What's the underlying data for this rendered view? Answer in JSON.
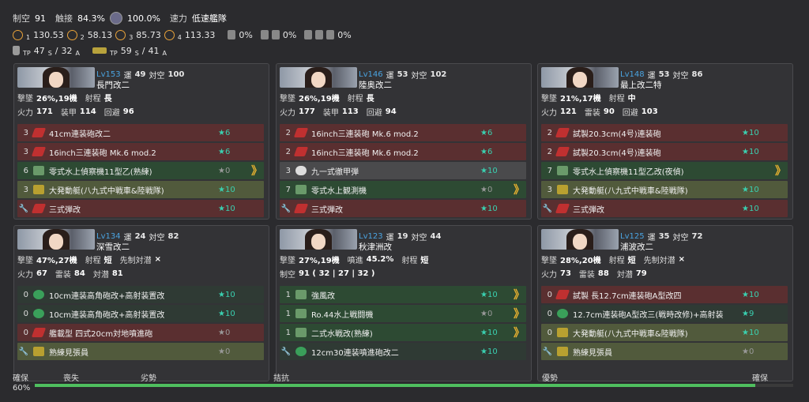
{
  "summary": {
    "air_label": "制空",
    "air_value": "91",
    "contact_label": "触接",
    "contact_value": "84.3%",
    "select_value": "100.0%",
    "speed_label": "速力",
    "speed_value": "低速艦隊",
    "los": [
      "130.53",
      "58.13",
      "85.73",
      "113.33"
    ],
    "los_subs": [
      "1",
      "2",
      "3",
      "4"
    ],
    "pct1": "0%",
    "pct2": "0%",
    "pct3": "0%",
    "tp1": "47",
    "tp1s": "S",
    "tp1b": "32",
    "tp1bs": "A",
    "tp2": "59",
    "tp2s": "S",
    "tp2b": "41",
    "tp2bs": "A",
    "tp_label": "TP"
  },
  "ships": [
    {
      "lv": "Lv153",
      "luck_label": "運",
      "luck": "49",
      "aa_label": "対空",
      "aa": "100",
      "name": "長門改二",
      "line1": [
        [
          "撃墜",
          "26%,19機"
        ],
        [
          "射程",
          "長"
        ]
      ],
      "line2": [
        [
          "火力",
          "171"
        ],
        [
          "装甲",
          "114"
        ],
        [
          "回避",
          "96"
        ]
      ],
      "equip": [
        {
          "cnt": "3",
          "name": "41cm連装砲改二",
          "star": "★6",
          "prof": "",
          "type": "red",
          "icon": "red"
        },
        {
          "cnt": "3",
          "name": "16inch三連装砲 Mk.6 mod.2",
          "star": "★6",
          "prof": "",
          "type": "red",
          "icon": "red"
        },
        {
          "cnt": "6",
          "name": "零式水上偵察機11型乙(熟練)",
          "star": "★0",
          "prof": "》",
          "type": "green",
          "icon": "plane"
        },
        {
          "cnt": "3",
          "name": "大発動艇(八九式中戦車&陸戦隊)",
          "star": "★10",
          "prof": "",
          "type": "olive",
          "icon": "olive"
        },
        {
          "cnt": "🔧",
          "name": "三式弾改",
          "star": "★10",
          "prof": "",
          "type": "red",
          "icon": "red"
        }
      ]
    },
    {
      "lv": "Lv146",
      "luck_label": "運",
      "luck": "53",
      "aa_label": "対空",
      "aa": "102",
      "name": "陸奥改二",
      "line1": [
        [
          "撃墜",
          "26%,19機"
        ],
        [
          "射程",
          "長"
        ]
      ],
      "line2": [
        [
          "火力",
          "177"
        ],
        [
          "装甲",
          "113"
        ],
        [
          "回避",
          "94"
        ]
      ],
      "equip": [
        {
          "cnt": "2",
          "name": "16inch三連装砲 Mk.6 mod.2",
          "star": "★6",
          "prof": "",
          "type": "red",
          "icon": "red"
        },
        {
          "cnt": "2",
          "name": "16inch三連装砲 Mk.6 mod.2",
          "star": "★6",
          "prof": "",
          "type": "red",
          "icon": "red"
        },
        {
          "cnt": "3",
          "name": "九一式徹甲弾",
          "star": "★10",
          "prof": "",
          "type": "grey",
          "icon": "white"
        },
        {
          "cnt": "7",
          "name": "零式水上観測機",
          "star": "★0",
          "prof": "》",
          "type": "green",
          "icon": "plane"
        },
        {
          "cnt": "🔧",
          "name": "三式弾改",
          "star": "★10",
          "prof": "",
          "type": "red",
          "icon": "red"
        }
      ]
    },
    {
      "lv": "Lv148",
      "luck_label": "運",
      "luck": "53",
      "aa_label": "対空",
      "aa": "86",
      "name": "最上改二特",
      "line1": [
        [
          "撃墜",
          "21%,17機"
        ],
        [
          "射程",
          "中"
        ]
      ],
      "line2": [
        [
          "火力",
          "121"
        ],
        [
          "雷装",
          "90"
        ],
        [
          "回避",
          "103"
        ]
      ],
      "equip": [
        {
          "cnt": "2",
          "name": "試製20.3cm(4号)連装砲",
          "star": "★10",
          "prof": "",
          "type": "red",
          "icon": "red"
        },
        {
          "cnt": "2",
          "name": "試製20.3cm(4号)連装砲",
          "star": "★10",
          "prof": "",
          "type": "red",
          "icon": "red"
        },
        {
          "cnt": "7",
          "name": "零式水上偵察機11型乙改(夜偵)",
          "star": "",
          "prof": "》",
          "type": "green",
          "icon": "plane"
        },
        {
          "cnt": "3",
          "name": "大発動艇(八九式中戦車&陸戦隊)",
          "star": "★10",
          "prof": "",
          "type": "olive",
          "icon": "olive"
        },
        {
          "cnt": "🔧",
          "name": "三式弾改",
          "star": "★10",
          "prof": "",
          "type": "red",
          "icon": "red"
        }
      ]
    },
    {
      "lv": "Lv134",
      "luck_label": "運",
      "luck": "24",
      "aa_label": "対空",
      "aa": "82",
      "name": "深雪改二",
      "line1": [
        [
          "撃墜",
          "47%,27機"
        ],
        [
          "射程",
          "短"
        ],
        [
          "先制対潜",
          "×"
        ]
      ],
      "line2": [
        [
          "火力",
          "67"
        ],
        [
          "雷装",
          "84"
        ],
        [
          "対潜",
          "81"
        ]
      ],
      "equip": [
        {
          "cnt": "0",
          "name": "10cm連装高角砲改+高射装置改",
          "star": "★10",
          "prof": "",
          "type": "dark",
          "icon": "green"
        },
        {
          "cnt": "0",
          "name": "10cm連装高角砲改+高射装置改",
          "star": "★10",
          "prof": "",
          "type": "dark",
          "icon": "green"
        },
        {
          "cnt": "0",
          "name": "艦載型 四式20cm対地噴進砲",
          "star": "★0",
          "prof": "",
          "type": "red",
          "icon": "red"
        },
        {
          "cnt": "🔧",
          "name": "熟練見張員",
          "star": "★0",
          "prof": "",
          "type": "olive",
          "icon": "olive"
        }
      ]
    },
    {
      "lv": "Lv123",
      "luck_label": "運",
      "luck": "19",
      "aa_label": "対空",
      "aa": "44",
      "name": "秋津洲改",
      "line1": [
        [
          "撃墜",
          "27%,19機"
        ],
        [
          "噴進",
          "45.2%"
        ],
        [
          "射程",
          "短"
        ]
      ],
      "line2": [
        [
          "制空",
          "91 ( 32 | 27 | 32 )"
        ]
      ],
      "equip": [
        {
          "cnt": "1",
          "name": "強風改",
          "star": "★10",
          "prof": "》",
          "type": "green",
          "icon": "plane"
        },
        {
          "cnt": "1",
          "name": "Ro.44水上戦闘機",
          "star": "★0",
          "prof": "》",
          "type": "green",
          "icon": "plane"
        },
        {
          "cnt": "1",
          "name": "二式水戦改(熟練)",
          "star": "★10",
          "prof": "》",
          "type": "green",
          "icon": "plane"
        },
        {
          "cnt": "🔧",
          "name": "12cm30連装噴進砲改二",
          "star": "★10",
          "prof": "",
          "type": "dark",
          "icon": "green"
        }
      ]
    },
    {
      "lv": "Lv125",
      "luck_label": "運",
      "luck": "35",
      "aa_label": "対空",
      "aa": "72",
      "name": "浦波改二",
      "line1": [
        [
          "撃墜",
          "28%,20機"
        ],
        [
          "射程",
          "短"
        ],
        [
          "先制対潜",
          "×"
        ]
      ],
      "line2": [
        [
          "火力",
          "73"
        ],
        [
          "雷装",
          "88"
        ],
        [
          "対潜",
          "79"
        ]
      ],
      "equip": [
        {
          "cnt": "0",
          "name": "試製 長12.7cm連装砲A型改四",
          "star": "★10",
          "prof": "",
          "type": "red",
          "icon": "red"
        },
        {
          "cnt": "0",
          "name": "12.7cm連装砲A型改三(戦時改修)+高射装",
          "star": "★9",
          "prof": "",
          "type": "dark",
          "icon": "green"
        },
        {
          "cnt": "0",
          "name": "大発動艇(八九式中戦車&陸戦隊)",
          "star": "★10",
          "prof": "",
          "type": "olive",
          "icon": "olive"
        },
        {
          "cnt": "🔧",
          "name": "熟練見張員",
          "star": "★0",
          "prof": "",
          "type": "olive",
          "icon": "olive"
        }
      ]
    }
  ],
  "bottom": {
    "left_label": "確保",
    "pct": "60%",
    "labels": [
      "喪失",
      "劣勢",
      "拮抗",
      "優勢",
      "確保"
    ],
    "fill": 0.95
  }
}
